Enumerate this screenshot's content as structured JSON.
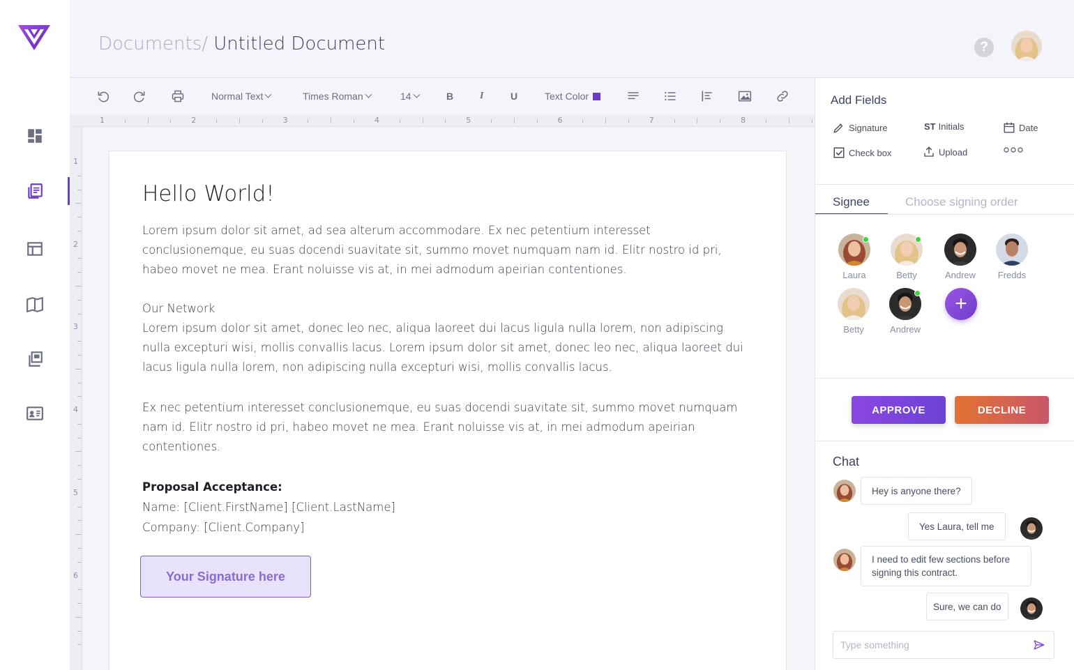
{
  "header": {
    "breadcrumb_root": "Documents/",
    "breadcrumb_current": " Untitled Document",
    "help_label": "?"
  },
  "sidebar": {
    "items": [
      {
        "icon": "dashboard-icon"
      },
      {
        "icon": "documents-icon",
        "active": true
      },
      {
        "icon": "templates-icon"
      },
      {
        "icon": "library-icon"
      },
      {
        "icon": "copies-icon"
      },
      {
        "icon": "contacts-icon"
      }
    ]
  },
  "toolbar": {
    "style": "Normal Text",
    "font": "Times Roman",
    "size": "14",
    "bold": "B",
    "italic": "I",
    "underline": "U",
    "text_color": "Text Color",
    "text_color_value": "#6a3cc8"
  },
  "ruler": {
    "top": [
      "1",
      "2",
      "3",
      "4",
      "5",
      "6",
      "7",
      "8"
    ],
    "left": [
      "1",
      "2",
      "3",
      "4",
      "5",
      "6"
    ]
  },
  "document": {
    "title": "Hello World!",
    "p1": "Lorem ipsum dolor sit amet, ad sea alterum accommodare. Ex nec petentium interesset conclusionemque, eu suas docendi suavitate sit, summo movet numquam nam id. Elitr nostro id pri, habeo movet ne mea. Erant noluisse vis at, in mei admodum apeirian contentiones.",
    "heading2": "Our Network",
    "p2": "Lorem ipsum dolor sit amet, donec leo nec, aliqua laoreet dui lacus ligula nulla lorem, non adipiscing nulla excepturi wisi, mollis convallis lacus. Lorem ipsum dolor sit amet, donec leo nec, aliqua laoreet dui lacus ligula nulla lorem, non adipiscing nulla excepturi wisi, mollis convallis lacus.",
    "p3": "Ex nec petentium interesset conclusionemque, eu suas docendi suavitate sit, summo movet numquam nam id. Elitr nostro id pri, habeo movet ne mea. Erant noluisse vis at, in mei admodum apeirian contentiones.",
    "proposal_heading": "Proposal Acceptance:",
    "name_line": "Name: [Client.FirstName] [Client.LastName]",
    "company_line": "Company: [Client.Company]",
    "signature_placeholder": "Your Signature here"
  },
  "panel": {
    "add_fields_title": "Add Fields",
    "fields": {
      "signature": "Signature",
      "initials": "Initials",
      "initials_prefix": "ST",
      "date": "Date",
      "checkbox": "Check box",
      "upload": "Upload"
    },
    "tabs": {
      "signee": "Signee",
      "order": "Choose signing order"
    },
    "signees": [
      {
        "name": "Laura",
        "online": true
      },
      {
        "name": "Betty",
        "online": true
      },
      {
        "name": "Andrew",
        "online": false
      },
      {
        "name": "Fredds",
        "online": false
      },
      {
        "name": "Betty",
        "online": false
      },
      {
        "name": "Andrew",
        "online": true
      }
    ],
    "approve": "APPROVE",
    "decline": "DECLINE"
  },
  "chat": {
    "title": "Chat",
    "messages": [
      {
        "from": "Laura",
        "text": "Hey is anyone there?"
      },
      {
        "from": "Andrew",
        "text": "Yes Laura, tell me"
      },
      {
        "from": "Laura",
        "text": "I need to edit few sections before signing this contract."
      },
      {
        "from": "Andrew",
        "text": "Sure, we can do"
      }
    ],
    "input_placeholder": "Type something"
  },
  "colors": {
    "accent": "#6a3cc8",
    "approve": "#7d44dc",
    "decline": "#d9643f",
    "online": "#3fd23f"
  }
}
